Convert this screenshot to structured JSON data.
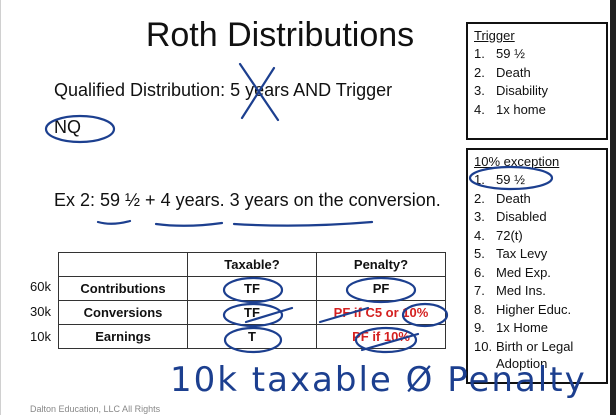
{
  "title": "Roth Distributions",
  "qualified": {
    "text": "Qualified Distribution: 5 years AND Trigger",
    "nq_label": "NQ"
  },
  "example": {
    "text": "Ex 2: 59 ½ + 4 years.  3 years on the conversion."
  },
  "trigger_box": {
    "title": "Trigger",
    "items": [
      "59 ½",
      "Death",
      "Disability",
      "1x home"
    ]
  },
  "exception_box": {
    "title": "10% exception",
    "items": [
      "59 ½",
      "Death",
      "Disabled",
      "72(t)",
      "Tax Levy",
      "Med Exp.",
      "Med Ins.",
      "Higher Educ.",
      "1x Home",
      "Birth or Legal",
      "Adoption"
    ]
  },
  "table": {
    "headers": [
      "",
      "Taxable?",
      "Penalty?"
    ],
    "rows": [
      {
        "amount": "60k",
        "label": "Contributions",
        "taxable": "TF",
        "penalty": "PF"
      },
      {
        "amount": "30k",
        "label": "Conversions",
        "taxable": "TF",
        "penalty": "PF if C5 or 10%"
      },
      {
        "amount": "10k",
        "label": "Earnings",
        "taxable": "T",
        "penalty": "PF if 10%"
      }
    ]
  },
  "handwriting": {
    "note": "10k taxable Ø Penalty"
  },
  "footer": {
    "text": "Dalton Education, LLC All Rights"
  },
  "colors": {
    "ink": "#1c3f8f",
    "red_text": "#d42020"
  }
}
